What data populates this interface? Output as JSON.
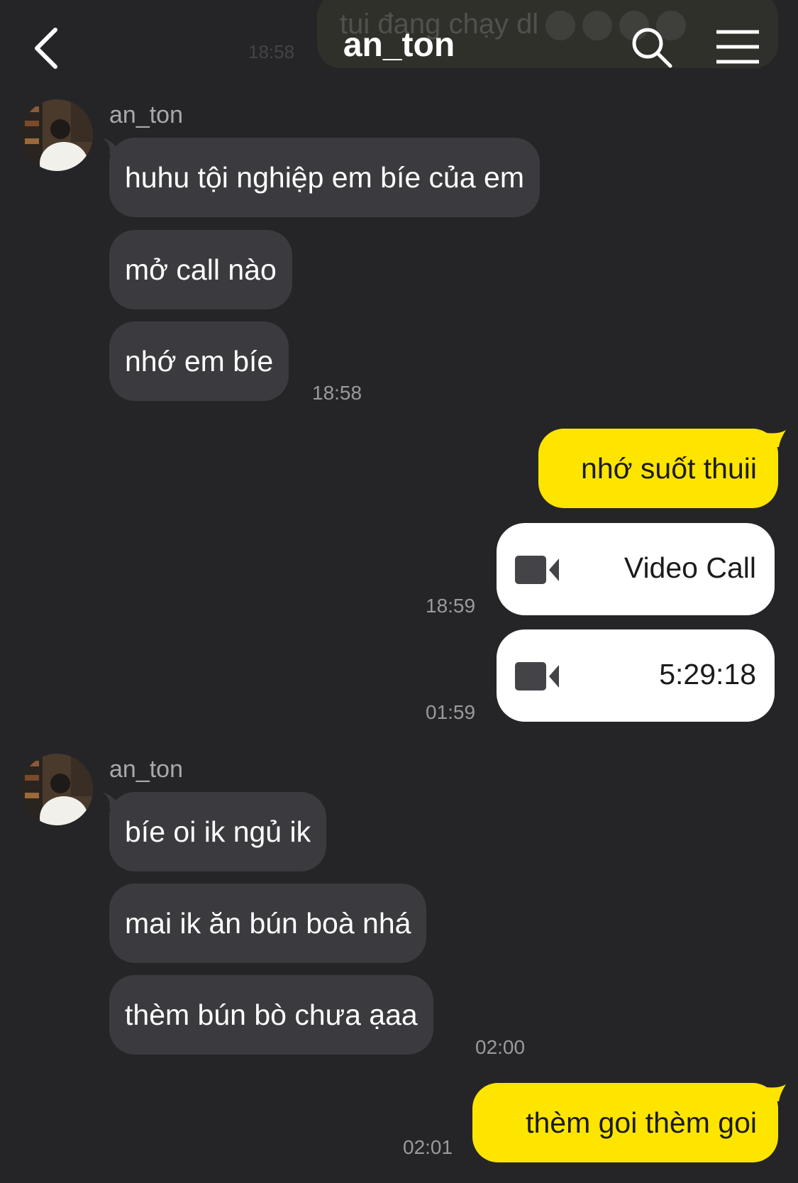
{
  "header": {
    "title": "an_ton",
    "faded_message": "tui đang chạy dl",
    "faded_time": "18:58"
  },
  "messages": {
    "group1": {
      "sender": "an_ton",
      "m1": "huhu tội nghiệp em bíe của em",
      "m2": "mở call nào",
      "m3": "nhớ em bíe",
      "time": "18:58"
    },
    "me1": {
      "text": "nhớ suốt thuii"
    },
    "call1": {
      "label": "Video Call",
      "time": "18:59"
    },
    "call2": {
      "label": "5:29:18",
      "time": "01:59"
    },
    "group2": {
      "sender": "an_ton",
      "m1": "bíe oi ik ngủ ik",
      "m2": "mai ik ăn bún boà nhá",
      "m3": "thèm bún bò chưa ạaa",
      "time": "02:00"
    },
    "me2": {
      "text": "thèm goi thèm goi",
      "time": "02:01"
    }
  },
  "colors": {
    "background": "#252528",
    "incoming_bubble": "#3b3b3f",
    "outgoing_bubble": "#fee500",
    "call_card": "#ffffff"
  },
  "icons": [
    "back-chevron-icon",
    "search-icon",
    "menu-icon",
    "video-camera-icon"
  ]
}
